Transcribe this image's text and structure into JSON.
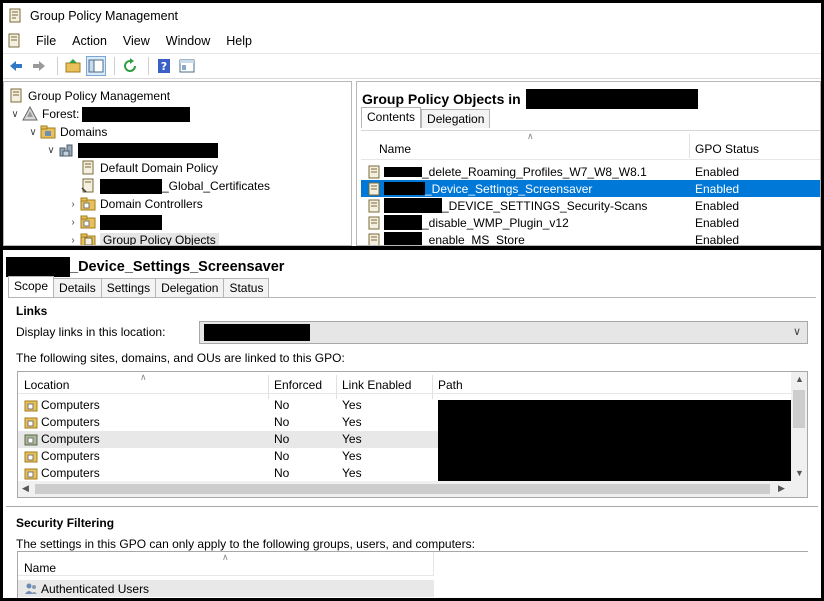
{
  "window": {
    "title": "Group Policy Management"
  },
  "menu": {
    "items": [
      "File",
      "Action",
      "View",
      "Window",
      "Help"
    ]
  },
  "toolbar": {
    "buttons": [
      "back-icon",
      "forward-icon",
      "up-folder-icon",
      "show-hide-tree-icon",
      "refresh-icon",
      "help-icon",
      "properties-icon"
    ]
  },
  "tree": {
    "root": "Group Policy Management",
    "forest_label": "Forest:",
    "domains": "Domains",
    "default_domain_policy": "Default Domain Policy",
    "certificates_suffix": "_Global_Certificates",
    "domain_controllers": "Domain Controllers",
    "group_policy_objects": "Group Policy Objects"
  },
  "gpo_list": {
    "title": "Group Policy Objects in",
    "tabs": [
      "Contents",
      "Delegation"
    ],
    "columns": {
      "name": "Name",
      "status": "GPO Status"
    },
    "rows": [
      {
        "name": "_delete_Roaming_Profiles_W7_W8_W8.1",
        "status": "Enabled"
      },
      {
        "name": "_Device_Settings_Screensaver",
        "status": "Enabled"
      },
      {
        "name": "_DEVICE_SETTINGS_Security-Scans",
        "status": "Enabled"
      },
      {
        "name": "_disable_WMP_Plugin_v12",
        "status": "Enabled"
      },
      {
        "name": "_enable_MS_Store",
        "status": "Enabled"
      }
    ]
  },
  "details": {
    "title_suffix": "_Device_Settings_Screensaver",
    "tabs": [
      "Scope",
      "Details",
      "Settings",
      "Delegation",
      "Status"
    ],
    "links": {
      "heading": "Links",
      "display_label": "Display links in this location:",
      "linked_text": "The following sites, domains, and OUs are linked to this GPO:",
      "columns": {
        "location": "Location",
        "enforced": "Enforced",
        "link_enabled": "Link Enabled",
        "path": "Path"
      },
      "rows": [
        {
          "location": "Computers",
          "enforced": "No",
          "link_enabled": "Yes"
        },
        {
          "location": "Computers",
          "enforced": "No",
          "link_enabled": "Yes"
        },
        {
          "location": "Computers",
          "enforced": "No",
          "link_enabled": "Yes"
        },
        {
          "location": "Computers",
          "enforced": "No",
          "link_enabled": "Yes"
        },
        {
          "location": "Computers",
          "enforced": "No",
          "link_enabled": "Yes"
        }
      ]
    },
    "security": {
      "heading": "Security Filtering",
      "description": "The settings in this GPO can only apply to the following groups, users, and computers:",
      "column_name": "Name",
      "rows": [
        "Authenticated Users"
      ]
    }
  },
  "colors": {
    "selection": "#0078d7",
    "folder": "#e8c15a",
    "redaction": "#000000"
  }
}
